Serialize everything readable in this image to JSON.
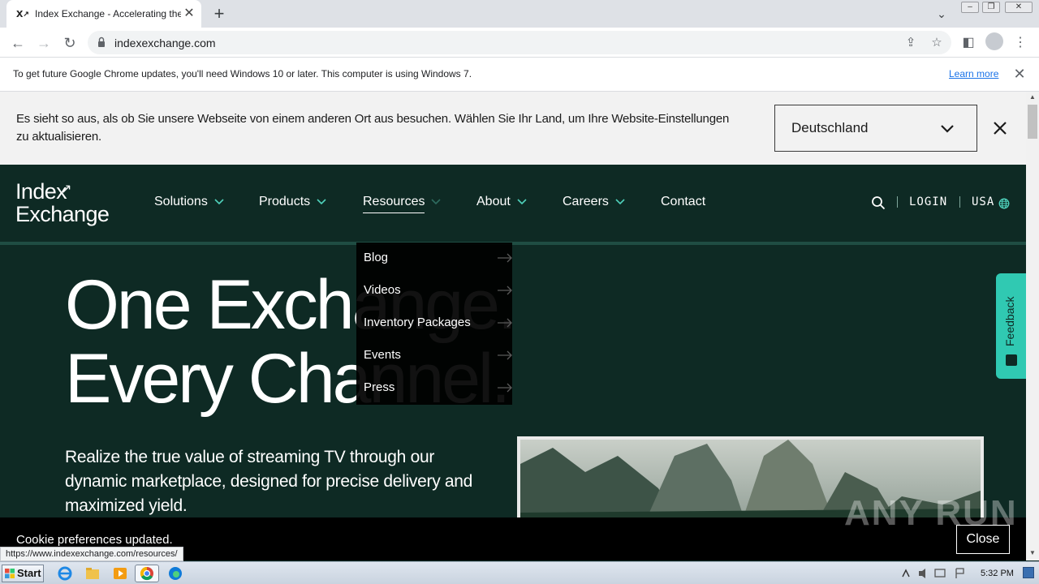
{
  "browser": {
    "tab_title": "Index Exchange - Accelerating the E",
    "tab_favicon": "x-logo-icon",
    "url": "indexexchange.com",
    "status_url": "https://www.indexexchange.com/resources/"
  },
  "infobar": {
    "message": "To get future Google Chrome updates, you'll need Windows 10 or later. This computer is using Windows 7.",
    "learn_more": "Learn more"
  },
  "geo_banner": {
    "text": "Es sieht so aus, als ob Sie unsere Webseite von einem anderen Ort aus besuchen. Wählen Sie Ihr Land, um Ihre Website-Einstellungen zu aktualisieren.",
    "selected_country": "Deutschland"
  },
  "site_nav": {
    "logo_line1": "Index",
    "logo_line2": "Exchange",
    "items": [
      {
        "label": "Solutions"
      },
      {
        "label": "Products"
      },
      {
        "label": "Resources"
      },
      {
        "label": "About"
      },
      {
        "label": "Careers"
      },
      {
        "label": "Contact"
      }
    ],
    "login": "LOGIN",
    "region": "USA"
  },
  "resources_menu": {
    "items": [
      {
        "label": "Blog"
      },
      {
        "label": "Videos"
      },
      {
        "label": "Inventory Packages"
      },
      {
        "label": "Events"
      },
      {
        "label": "Press"
      }
    ]
  },
  "hero": {
    "line1": "One Exchange.",
    "line2": "Every Channel.",
    "subtitle": "Realize the true value of streaming TV through our dynamic marketplace, designed for precise delivery and maximized yield."
  },
  "feedback": {
    "label": "Feedback"
  },
  "cookie": {
    "message": "Cookie preferences updated.",
    "close": "Close"
  },
  "watermark": "ANY RUN",
  "taskbar": {
    "start": "Start",
    "clock": "5:32 PM"
  },
  "colors": {
    "site_bg": "#0e2a24",
    "accent": "#30c9b2",
    "chrome_bg": "#dee1e6",
    "link": "#1a73e8"
  }
}
